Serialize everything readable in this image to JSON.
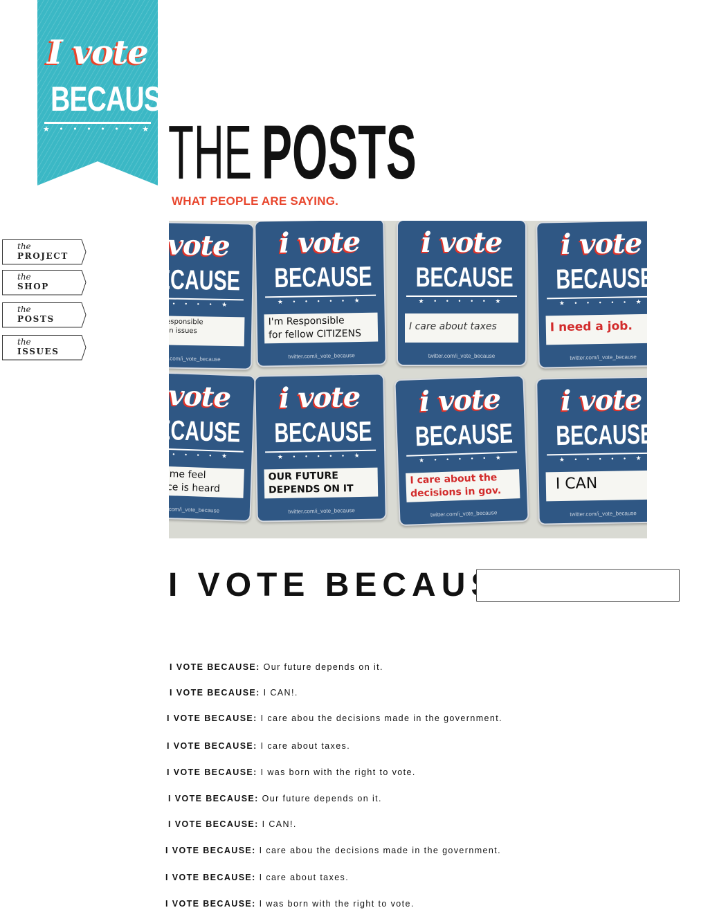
{
  "logo": {
    "line1": "I vote",
    "line2": "BECAUSE",
    "stars": "★ • • • • • • ★"
  },
  "header": {
    "title_light": "THE",
    "title_bold": "POSTS",
    "subtitle": "WHAT PEOPLE ARE SAYING."
  },
  "nav": {
    "items": [
      {
        "prefix": "the",
        "label": "PROJECT"
      },
      {
        "prefix": "the",
        "label": "SHOP"
      },
      {
        "prefix": "the",
        "label": "POSTS"
      },
      {
        "prefix": "the",
        "label": "ISSUES"
      }
    ]
  },
  "photo": {
    "sticker_title": "i vote",
    "sticker_subtitle": "BECAUSE",
    "sticker_stars": "★ • • • • • ★",
    "sticker_handle": "twitter.com/i_vote_because",
    "stickers": [
      {
        "text": "to elect responsible\nto focus on issues"
      },
      {
        "text": "I'm Responsible\nfor fellow CITIZENS"
      },
      {
        "text": "I care about taxes"
      },
      {
        "text": "I need a job."
      },
      {
        "text": "makes me feel\nmy voice is heard"
      },
      {
        "text": "OUR FUTURE\nDEPENDS ON IT"
      },
      {
        "text": "I care about the\ndecisions in gov."
      },
      {
        "text": "I CAN"
      }
    ],
    "colors": {
      "sticker": "#2f5784",
      "accent": "#e0342a",
      "wall": "#d9dad3"
    }
  },
  "form": {
    "label": "I VOTE BECAUSE:",
    "input_value": "",
    "input_placeholder": ""
  },
  "posts": [
    {
      "prefix": "I VOTE BECAUSE:",
      "text": "Our future depends on it."
    },
    {
      "prefix": "I VOTE BECAUSE:",
      "text": "I CAN!."
    },
    {
      "prefix": "I VOTE BECAUSE:",
      "text": "I care abou the decisions made in the government."
    },
    {
      "prefix": "I VOTE BECAUSE:",
      "text": "I care about taxes."
    },
    {
      "prefix": "I VOTE BECAUSE:",
      "text": "I was born with the right to vote."
    },
    {
      "prefix": "I VOTE BECAUSE:",
      "text": "Our future depends on it."
    },
    {
      "prefix": "I VOTE BECAUSE:",
      "text": "I CAN!."
    },
    {
      "prefix": "I VOTE BECAUSE:",
      "text": "I care abou the decisions made in the government."
    },
    {
      "prefix": "I VOTE BECAUSE:",
      "text": "I care about taxes."
    },
    {
      "prefix": "I VOTE BECAUSE:",
      "text": "I was born with the right to vote."
    }
  ],
  "colors": {
    "brand_teal": "#3bb8c5",
    "accent_red": "#e8452c",
    "text": "#111111"
  }
}
